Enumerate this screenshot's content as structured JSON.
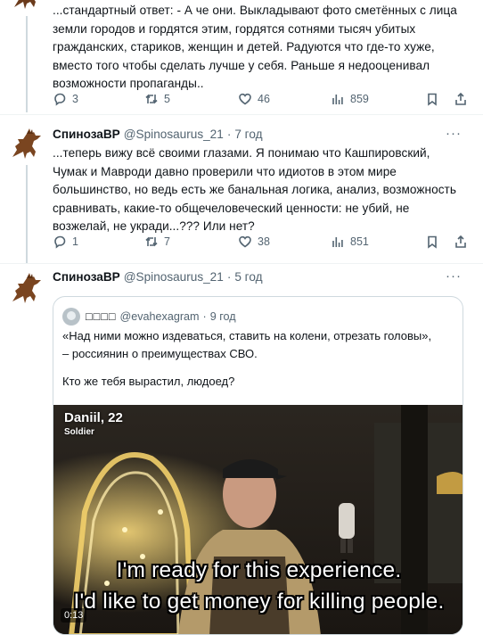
{
  "tweets": [
    {
      "body_lines": [
        "...стандартный ответ: - А че они. Выкладывают фото сметённых с лица",
        "земли городов и гордятся этим, гордятся сотнями тысяч убитых",
        "гражданских, стариков, женщин и детей. Радуются что где-то хуже,",
        "вместо того чтобы сделать лучше у себя. Раньше я недооценивал",
        "возможности пропаганды.."
      ],
      "replies": "3",
      "retweets": "5",
      "likes": "46",
      "views": "859"
    },
    {
      "author": "СпинозаВР",
      "handle": "@Spinosaurus_21",
      "time": "7 год",
      "body_lines": [
        "...теперь вижу всё своими глазами. Я понимаю что Кашпировский,",
        "Чумак и Мавроди давно проверили что идиотов в этом мире",
        "большинство, но ведь есть же банальная логика, анализ, возможность",
        "сравнивать, какие-то общечеловеческий ценности: не убий, не",
        "возжелай, не укради...??? Или нет?"
      ],
      "replies": "1",
      "retweets": "7",
      "likes": "38",
      "views": "851"
    },
    {
      "author": "СпинозаВР",
      "handle": "@Spinosaurus_21",
      "time": "5 год",
      "quote": {
        "name": "□□□□",
        "handle": "@evahexagram",
        "time": "9 год",
        "lines": [
          "«Над ними можно издеваться, ставить на колени, отрезать головы»,",
          "– россиянин о преимуществах СВО."
        ],
        "question": "Кто же тебя вырастил, людоед?",
        "video": {
          "caption_name": "Daniil, 22",
          "caption_role": "Soldier",
          "subtitle_1": "I'm ready for this experience.",
          "subtitle_2": "I'd like to get money for killing people.",
          "timer": "0:13"
        }
      }
    }
  ],
  "header_fragment": "\"Ґ",
  "more_label": "···",
  "colors": {
    "text": "#0f1419",
    "secondary": "#536471",
    "border": "#cfd9de",
    "divider": "#eff3f4"
  }
}
